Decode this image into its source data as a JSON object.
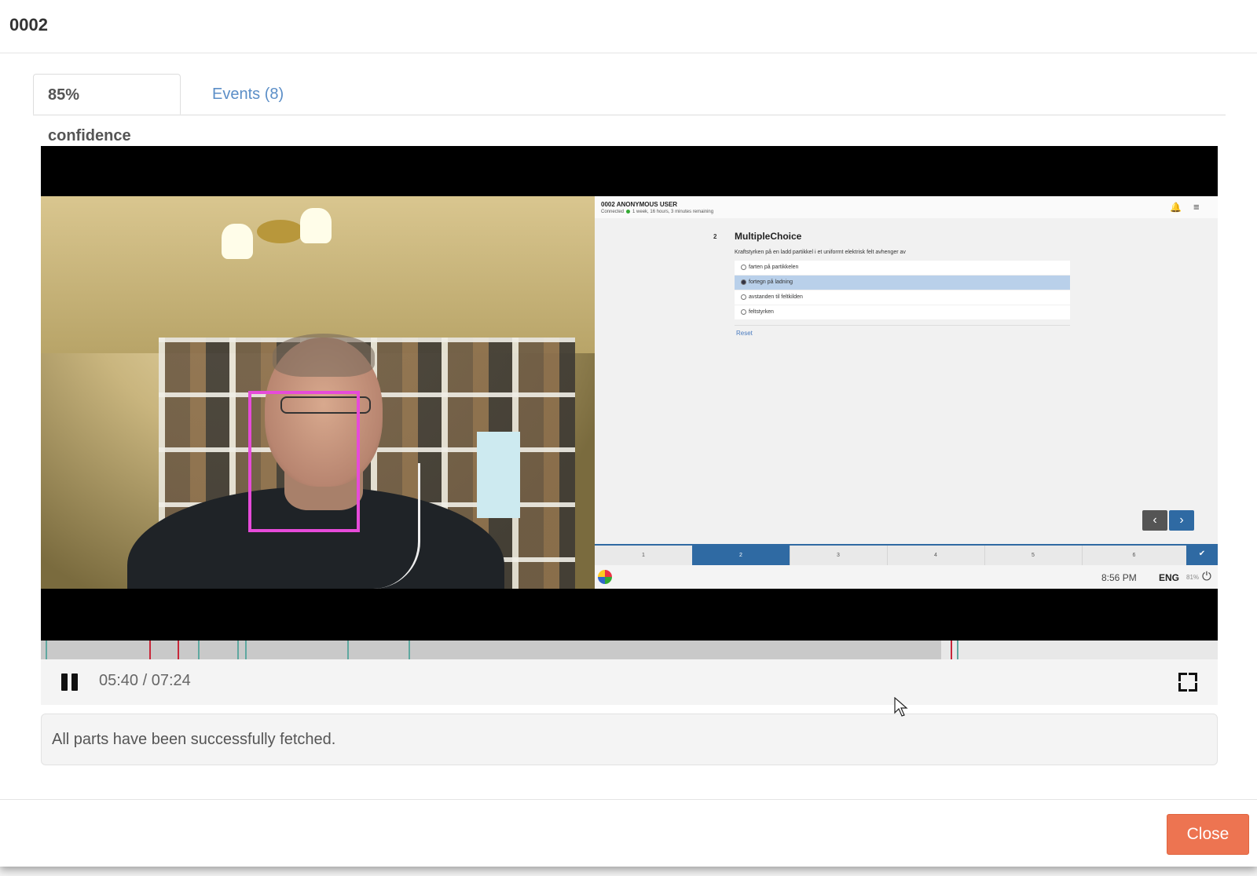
{
  "modal": {
    "title": "0002"
  },
  "tabs": [
    {
      "label": "85% confidence",
      "active": true
    },
    {
      "label": "Events (8)",
      "active": false
    }
  ],
  "screen": {
    "user": "0002 ANONYMOUS USER",
    "connection_label": "Connected",
    "time_remaining": "1 week, 16 hours, 3 minutes remaining",
    "question_number": "2",
    "question_title": "MultipleChoice",
    "question_text": "Kraftstyrken på en ladd partikkel i et uniformt elektrisk felt avhenger av",
    "options": [
      {
        "label": "farten på partikkelen",
        "selected": false
      },
      {
        "label": "fortegn på ladning",
        "selected": true
      },
      {
        "label": "avstanden til feltkilden",
        "selected": false
      },
      {
        "label": "feltstyrken",
        "selected": false
      }
    ],
    "reset_label": "Reset",
    "steps": [
      "1",
      "2",
      "3",
      "4",
      "5",
      "6"
    ],
    "active_step": "2",
    "clock": "8:56 PM",
    "language": "ENG",
    "battery": "81%"
  },
  "player": {
    "current_time": "05:40",
    "duration": "07:24",
    "time_display": "05:40 / 07:24",
    "progress_fraction": 0.765,
    "marker_colors": {
      "event": "#5fa8a0",
      "alert": "#c8283a"
    }
  },
  "notice": {
    "text": "All parts have been successfully fetched."
  },
  "footer": {
    "close_label": "Close"
  },
  "colors": {
    "accent_button": "#ed7451",
    "tab_link": "#5b8ec7",
    "face_box": "#e64bd9"
  }
}
